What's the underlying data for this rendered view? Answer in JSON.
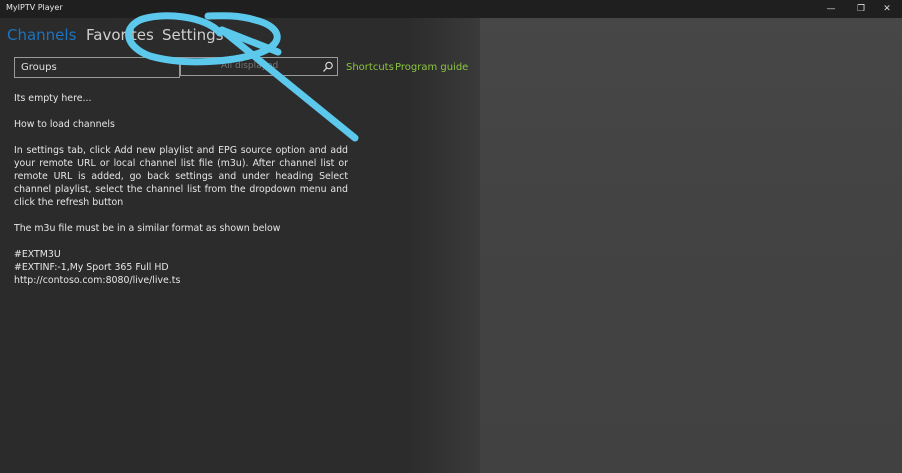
{
  "app": {
    "title": "MyIPTV Player"
  },
  "window_controls": {
    "minimize": "—",
    "restore": "❐",
    "close": "✕"
  },
  "tabs": [
    {
      "label": "Channels",
      "active": true
    },
    {
      "label": "Favorites",
      "active": false
    },
    {
      "label": "Settings",
      "active": false
    }
  ],
  "toolbar": {
    "groups_value": "Groups",
    "search_placeholder": "All displayed",
    "shortcuts_label": "Shortcuts",
    "program_guide_label": "Program guide"
  },
  "content": {
    "empty_message": "Its empty here...",
    "how_to_heading": "How to load  channels",
    "instructions": "In settings tab, click Add new playlist and EPG source  option and add your remote URL or local channel list file (m3u). After channel list or remote URL is added, go back settings and under heading  Select channel playlist, select the channel list from the dropdown menu and click the refresh button",
    "format_note": "The m3u file must be in a similar format as shown below",
    "example_line1": "#EXTM3U",
    "example_line2": "#EXTINF:-1,My Sport 365 Full HD",
    "example_line3": "http://contoso.com:8080/live/live.ts"
  },
  "colors": {
    "accent": "#1e73be",
    "link": "#8cc63f",
    "annotation": "#5bc8ec"
  },
  "icons": {
    "search": "search-icon"
  }
}
